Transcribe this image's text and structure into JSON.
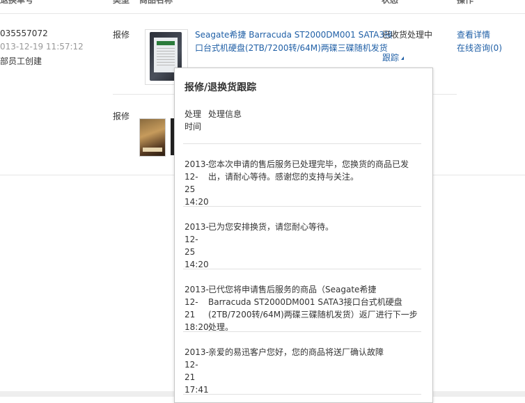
{
  "table_header": {
    "col_order_no": "退换单号",
    "col_type": "类型",
    "col_product": "商品名称",
    "col_status": "状态",
    "col_action": "操作"
  },
  "row1": {
    "order_no": "035557072",
    "date": "013-12-19 11:57:12",
    "creator": "部员工创建",
    "type": "报修",
    "product_name_line1": "Seagate希捷 Barracuda ST2000DM001 SATA3接",
    "product_name_line2": "口台式机硬盘(2TB/7200转/64M)两碟三碟随机发货",
    "status": "已收货处理中",
    "track_link": "跟踪",
    "action_detail": "查看详情",
    "action_consult": "在线咨询(0)"
  },
  "row2": {
    "type": "报修"
  },
  "popup": {
    "title": "报修/退换货跟踪",
    "col_time_line1": "处理",
    "col_time_line2": "时间",
    "col_info": "处理信息",
    "entries": [
      {
        "time_line1": "2013-",
        "time_line2": "12-25",
        "time_line3": "14:20",
        "info": "您本次申请的售后服务已处理完毕，您换货的商品已发出，请耐心等待。感谢您的支持与关注。"
      },
      {
        "time_line1": "2013-",
        "time_line2": "12-25",
        "time_line3": "14:20",
        "info": "已为您安排换货，请您耐心等待。"
      },
      {
        "time_line1": "2013-",
        "time_line2": "12-21",
        "time_line3": "18:20",
        "info": "已代您将申请售后服务的商品（Seagate希捷 Barracuda ST2000DM001 SATA3接口台式机硬盘(2TB/7200转/64M)两碟三碟随机发货）返厂进行下一步处理。"
      },
      {
        "time_line1": "2013-",
        "time_line2": "12-21",
        "time_line3": "17:41",
        "info": "亲爱的易迅客户您好，您的商品将送厂确认故障"
      }
    ]
  },
  "colors": {
    "link": "#1f5fa6",
    "border": "#e6e6e6",
    "muted": "#999999"
  }
}
